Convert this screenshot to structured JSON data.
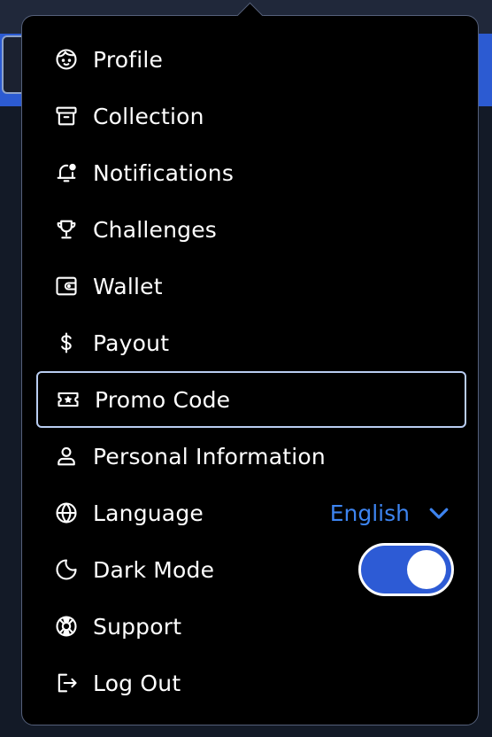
{
  "menu": {
    "items": [
      {
        "label": "Profile"
      },
      {
        "label": "Collection"
      },
      {
        "label": "Notifications"
      },
      {
        "label": "Challenges"
      },
      {
        "label": "Wallet"
      },
      {
        "label": "Payout"
      },
      {
        "label": "Promo Code"
      },
      {
        "label": "Personal Information"
      },
      {
        "label": "Language"
      },
      {
        "label": "Dark Mode"
      },
      {
        "label": "Support"
      },
      {
        "label": "Log Out"
      }
    ],
    "focused_item": "Promo Code",
    "language": {
      "selected": "English"
    },
    "dark_mode": {
      "enabled": true
    }
  },
  "icons": {
    "profile": "face-icon",
    "collection": "archive-icon",
    "notifications": "bell-icon",
    "challenges": "trophy-icon",
    "wallet": "wallet-icon",
    "payout": "dollar-icon",
    "promo_code": "ticket-icon",
    "personal_information": "user-icon",
    "language": "globe-icon",
    "dark_mode": "moon-icon",
    "support": "lifebuoy-icon",
    "log_out": "logout-icon"
  },
  "colors": {
    "menu_background": "#000000",
    "accent": "#3d84f0",
    "toggle_on": "#2d5bd5",
    "focus_ring": "#b9cdf2",
    "page_header_blue": "#2c5bd2"
  }
}
